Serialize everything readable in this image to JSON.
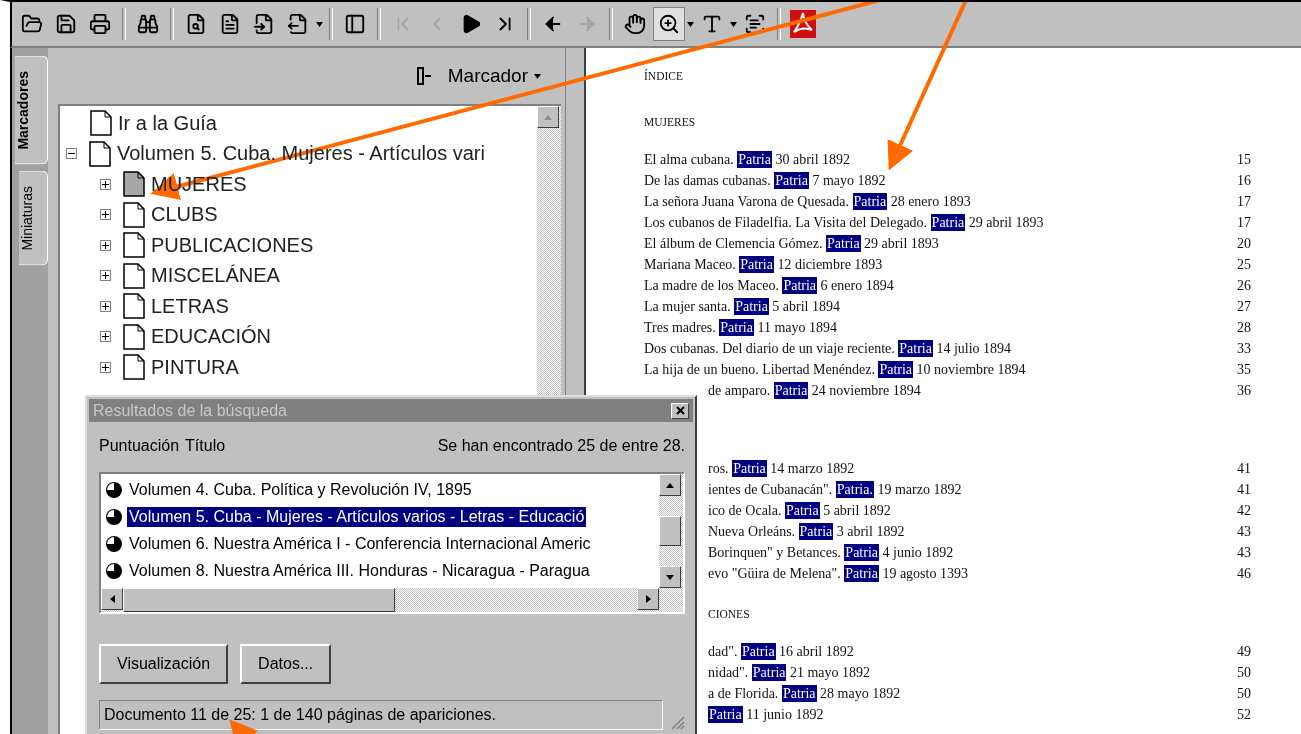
{
  "toolbar": {
    "buttons": [
      {
        "disabled": false,
        "pressed": false
      },
      {
        "disabled": false,
        "pressed": false
      },
      {
        "disabled": false,
        "pressed": false
      },
      {
        "disabled": false,
        "pressed": false
      },
      {
        "disabled": false,
        "pressed": false
      },
      {
        "disabled": false,
        "pressed": false
      },
      {
        "disabled": false,
        "pressed": false
      },
      {
        "disabled": false,
        "pressed": false
      },
      {
        "disabled": false,
        "pressed": false
      },
      {
        "disabled": true,
        "pressed": false
      },
      {
        "disabled": true,
        "pressed": false
      },
      {
        "disabled": false,
        "pressed": false
      },
      {
        "disabled": false,
        "pressed": false
      },
      {
        "disabled": false,
        "pressed": false
      },
      {
        "disabled": true,
        "pressed": false
      },
      {
        "disabled": false,
        "pressed": false
      },
      {
        "disabled": false,
        "pressed": true
      },
      {
        "disabled": false,
        "pressed": false
      },
      {
        "disabled": false,
        "pressed": false
      },
      {
        "disabled": false,
        "pressed": false
      }
    ]
  },
  "sidebar": {
    "tabs": [
      {
        "label": "Marcadores",
        "selected": true
      },
      {
        "label": "Miniaturas",
        "selected": false
      }
    ],
    "menu": "Marcador",
    "bookmarks": [
      {
        "label": "Ir a la Guía",
        "selected": false
      },
      {
        "label": "Volumen 5. Cuba. Mujeres - Artículos vari",
        "selected": false,
        "expanded": true,
        "children": [
          {
            "label": "MUJERES",
            "selected": true,
            "expanded": false
          },
          {
            "label": "CLUBS",
            "selected": false,
            "expanded": false
          },
          {
            "label": "PUBLICACIONES",
            "selected": false,
            "expanded": false
          },
          {
            "label": "MISCELÁNEA",
            "selected": false,
            "expanded": false
          },
          {
            "label": "LETRAS",
            "selected": false,
            "expanded": false
          },
          {
            "label": "EDUCACIÓN",
            "selected": false,
            "expanded": false
          },
          {
            "label": "PINTURA",
            "selected": false,
            "expanded": false
          }
        ]
      }
    ]
  },
  "document": {
    "title": "ÍNDICE",
    "sections": [
      {
        "heading": "MUJERES",
        "entries": [
          {
            "kind": "full",
            "before": "El alma cubana. ",
            "hit": "Patria",
            "after": " 30 abril 1892",
            "page": "15"
          },
          {
            "kind": "full",
            "before": "De las damas cubanas. ",
            "hit": "Patria",
            "after": " 7 mayo 1892",
            "page": "16"
          },
          {
            "kind": "full",
            "before": "La señora Juana Varona de Quesada. ",
            "hit": "Patria",
            "after": " 28 enero 1893",
            "page": "17"
          },
          {
            "kind": "full",
            "before": "Los cubanos de Filadelfia. La Visita del Delegado. ",
            "hit": "Patria",
            "after": " 29 abril 1893",
            "page": "17"
          },
          {
            "kind": "full",
            "before": "El álbum de Clemencia Gómez. ",
            "hit": "Patria",
            "after": " 29 abril 1893",
            "page": "20"
          },
          {
            "kind": "full",
            "before": "Mariana Maceo. ",
            "hit": "Patria",
            "after": " 12 diciembre 1893",
            "page": "25"
          },
          {
            "kind": "full",
            "before": "La madre de los Maceo. ",
            "hit": "Patria",
            "after": " 6 enero 1894",
            "page": "26"
          },
          {
            "kind": "full",
            "before": "La mujer santa. ",
            "hit": "Patria",
            "after": " 5 abril 1894",
            "page": "27"
          },
          {
            "kind": "full",
            "before": "Tres madres. ",
            "hit": "Patria",
            "after": " 11 mayo 1894",
            "page": "28"
          },
          {
            "kind": "full",
            "before": "Dos cubanas. Del diario de un viaje reciente. ",
            "hit": "Patria",
            "after": " 14 julio 1894",
            "page": "33"
          },
          {
            "kind": "full",
            "before": "La hija de un bueno. Libertad Menéndez. ",
            "hit": "Patria",
            "after": " 10 noviembre 1894",
            "page": "35"
          },
          {
            "kind": "cut",
            "before": "de amparo. ",
            "hit": "Patria",
            "after": " 24 noviembre 1894",
            "page": "36"
          }
        ]
      },
      {
        "entries": [
          {
            "kind": "cut",
            "before": "ros. ",
            "hit": "Patria",
            "after": " 14 marzo 1892",
            "page": "41"
          },
          {
            "kind": "cut",
            "before": "ientes de Cubanacán\". ",
            "hit": "Patria.",
            "after": " 19 marzo 1892",
            "page": "41"
          },
          {
            "kind": "cut",
            "before": "ico de Ocala. ",
            "hit": "Patria",
            "after": " 5 abril 1892",
            "page": "42"
          },
          {
            "kind": "cut",
            "before": "Nueva Orleáns. ",
            "hit": "Patria",
            "after": " 3 abril 1892",
            "page": "43"
          },
          {
            "kind": "cut",
            "before": "Borinquen\" y Betances. ",
            "hit": "Patria",
            "after": " 4 junio 1892",
            "page": "43"
          },
          {
            "kind": "cut",
            "before": "evo \"Güira de Melena\". ",
            "hit": "Patria",
            "after": " 19 agosto 1393",
            "page": "46"
          }
        ]
      },
      {
        "heading": "CIONES",
        "covered": true,
        "entries": [
          {
            "kind": "cut",
            "before": "dad\". ",
            "hit": "Patria",
            "after": " 16 abril 1892",
            "page": "49"
          },
          {
            "kind": "cut",
            "before": "nidad\". ",
            "hit": "Patria",
            "after": " 21 mayo 1892",
            "page": "50"
          },
          {
            "kind": "cut",
            "before": "a de Florida. ",
            "hit": "Patria",
            "after": " 28 mayo 1892",
            "page": "50"
          },
          {
            "kind": "cut",
            "hit": "Patria",
            "after": " 11 junio 1892",
            "page": "52"
          }
        ]
      }
    ]
  },
  "dialog": {
    "title": "Resultados de la búsqueda",
    "columns": [
      "Puntuación",
      "Título"
    ],
    "summary": "Se han encontrado 25 de entre 28.",
    "results": [
      {
        "label": "Volumen 4. Cuba. Política y Revolución IV, 1895",
        "selected": false
      },
      {
        "label": "Volumen 5. Cuba - Mujeres - Artículos varios - Letras - Educació",
        "selected": true
      },
      {
        "label": "Volumen 6. Nuestra América I - Conferencia Internacional Americ",
        "selected": false
      },
      {
        "label": "Volumen 8. Nuestra América III. Honduras - Nicaragua - Paragua",
        "selected": false
      }
    ],
    "buttons": [
      "Visualización",
      "Datos..."
    ],
    "status": "Documento 11 de 25: 1 de 140 páginas de apariciones."
  }
}
